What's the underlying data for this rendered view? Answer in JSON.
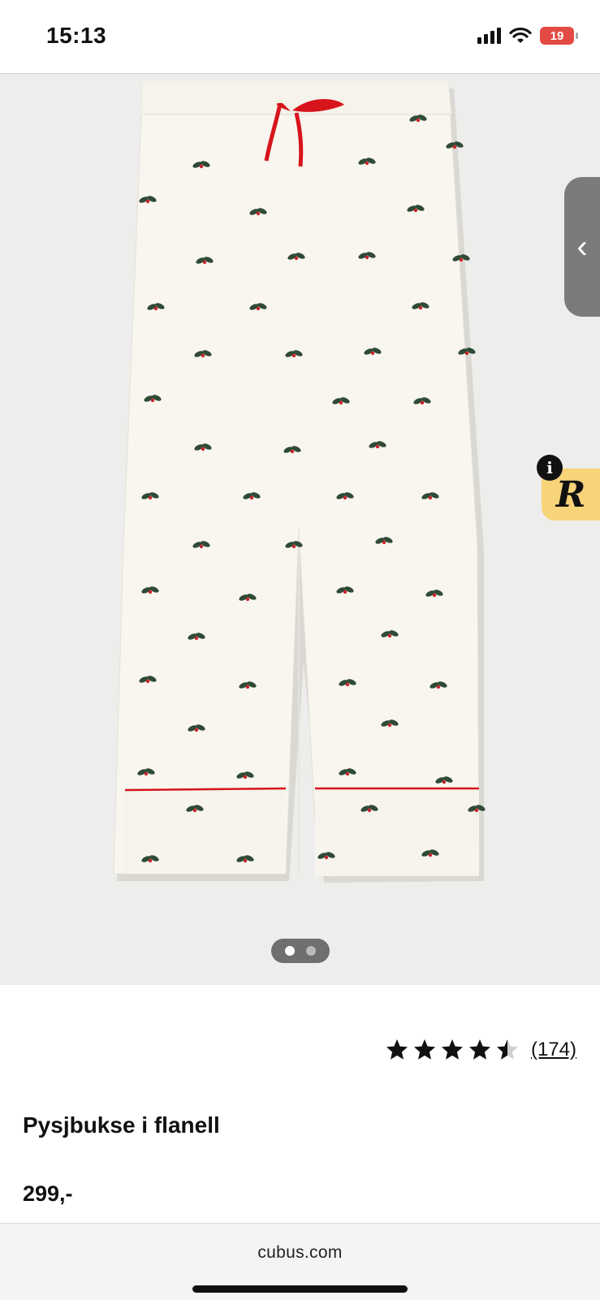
{
  "status_bar": {
    "time": "15:13",
    "battery": "19"
  },
  "product": {
    "title": "Pysjbukse i flanell",
    "price": "299,-",
    "rating_value": 4.5,
    "rating_max": 5,
    "review_count": "(174)"
  },
  "carousel": {
    "page_count": 2,
    "current_page": 1
  },
  "overlay": {
    "info_label": "i",
    "badge_letter": "R"
  },
  "browser": {
    "url": "cubus.com"
  },
  "colors": {
    "accent_red": "#d7141c",
    "badge_yellow": "#f7d37a",
    "battery_red": "#e24a43"
  }
}
